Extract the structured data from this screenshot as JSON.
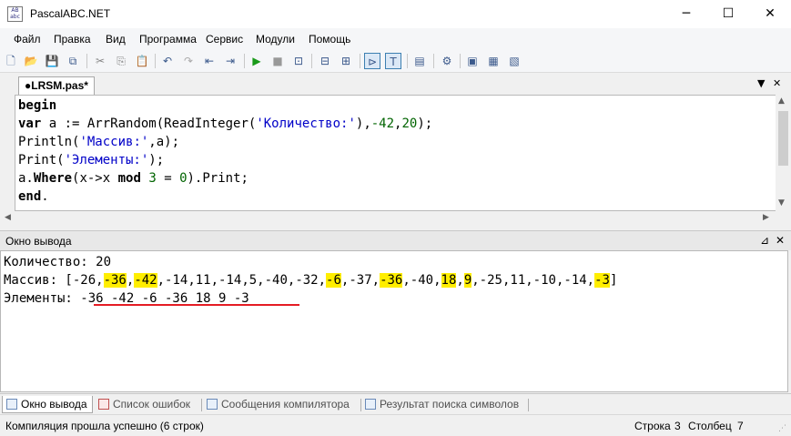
{
  "window": {
    "title": "PascalABC.NET",
    "icon_text": "AB\nabc",
    "controls": {
      "minimize": "─",
      "maximize": "☐",
      "close": "✕"
    }
  },
  "menu": [
    "Файл",
    "Правка",
    "Вид",
    "Программа",
    "Сервис",
    "Модули",
    "Помощь"
  ],
  "toolbar": {
    "icons": [
      "new-file-icon",
      "open-icon",
      "save-icon",
      "save-all-icon",
      "cut-icon",
      "copy-icon",
      "paste-icon",
      "undo-icon",
      "redo-icon",
      "toggle-comment-icon",
      "navigate-icon",
      "run-icon",
      "stop-icon",
      "debug-icon",
      "step-icon",
      "console-output-icon",
      "text-output-icon",
      "format-icon",
      "settings-icon",
      "module-icon",
      "compile-icon",
      "debug-window-icon"
    ]
  },
  "editor_tab": {
    "label": "●LRSM.pas*",
    "dropdown": "▼",
    "close": "✕"
  },
  "code": {
    "lines": [
      [
        {
          "t": "begin",
          "c": "kw"
        }
      ],
      [
        {
          "t": "var",
          "c": "kw"
        },
        {
          "t": " a := ArrRandom(ReadInteger(",
          "c": ""
        },
        {
          "t": "'Количество:'",
          "c": "str"
        },
        {
          "t": "),",
          "c": ""
        },
        {
          "t": "-42",
          "c": "num"
        },
        {
          "t": ",",
          "c": ""
        },
        {
          "t": "20",
          "c": "num"
        },
        {
          "t": ");",
          "c": ""
        }
      ],
      [
        {
          "t": "Println(",
          "c": ""
        },
        {
          "t": "'Массив:'",
          "c": "str"
        },
        {
          "t": ",a);",
          "c": ""
        }
      ],
      [
        {
          "t": "Print(",
          "c": ""
        },
        {
          "t": "'Элементы:'",
          "c": "str"
        },
        {
          "t": ");",
          "c": ""
        }
      ],
      [
        {
          "t": "a.",
          "c": ""
        },
        {
          "t": "Where",
          "c": "kw"
        },
        {
          "t": "(x->x ",
          "c": ""
        },
        {
          "t": "mod",
          "c": "kw"
        },
        {
          "t": " ",
          "c": ""
        },
        {
          "t": "3",
          "c": "num"
        },
        {
          "t": " = ",
          "c": ""
        },
        {
          "t": "0",
          "c": "num"
        },
        {
          "t": ").Print;",
          "c": ""
        }
      ],
      [
        {
          "t": "end",
          "c": "kw"
        },
        {
          "t": ".",
          "c": ""
        }
      ]
    ]
  },
  "output_panel": {
    "title": "Окно вывода",
    "pin": "⊿",
    "close": "✕",
    "lines": [
      [
        {
          "t": "Количество: 20",
          "h": false
        }
      ],
      [
        {
          "t": "Массив: [-26,",
          "h": false
        },
        {
          "t": "-36",
          "h": true
        },
        {
          "t": ",",
          "h": false
        },
        {
          "t": "-42",
          "h": true
        },
        {
          "t": ",-14,11,-14,5,-40,-32,",
          "h": false
        },
        {
          "t": "-6",
          "h": true
        },
        {
          "t": ",-37,",
          "h": false
        },
        {
          "t": "-36",
          "h": true
        },
        {
          "t": ",-40,",
          "h": false
        },
        {
          "t": "18",
          "h": true
        },
        {
          "t": ",",
          "h": false
        },
        {
          "t": "9",
          "h": true
        },
        {
          "t": ",-25,11,-10,-14,",
          "h": false
        },
        {
          "t": "-3",
          "h": true
        },
        {
          "t": "]",
          "h": false
        }
      ],
      [
        {
          "t": "Элементы: -36 -42 -6 -36 18 9 -3",
          "h": false
        }
      ]
    ]
  },
  "bottom_tabs": [
    "Окно вывода",
    "Список ошибок",
    "Сообщения компилятора",
    "Результат поиска символов"
  ],
  "status": {
    "message": "Компиляция прошла успешно (6 строк)",
    "row_label": "Строка",
    "row": "3",
    "col_label": "Столбец",
    "col": "7"
  },
  "colors": {
    "highlight": "#ffee00",
    "underline": "#e51c24",
    "string": "#0000c8",
    "number": "#006400"
  }
}
